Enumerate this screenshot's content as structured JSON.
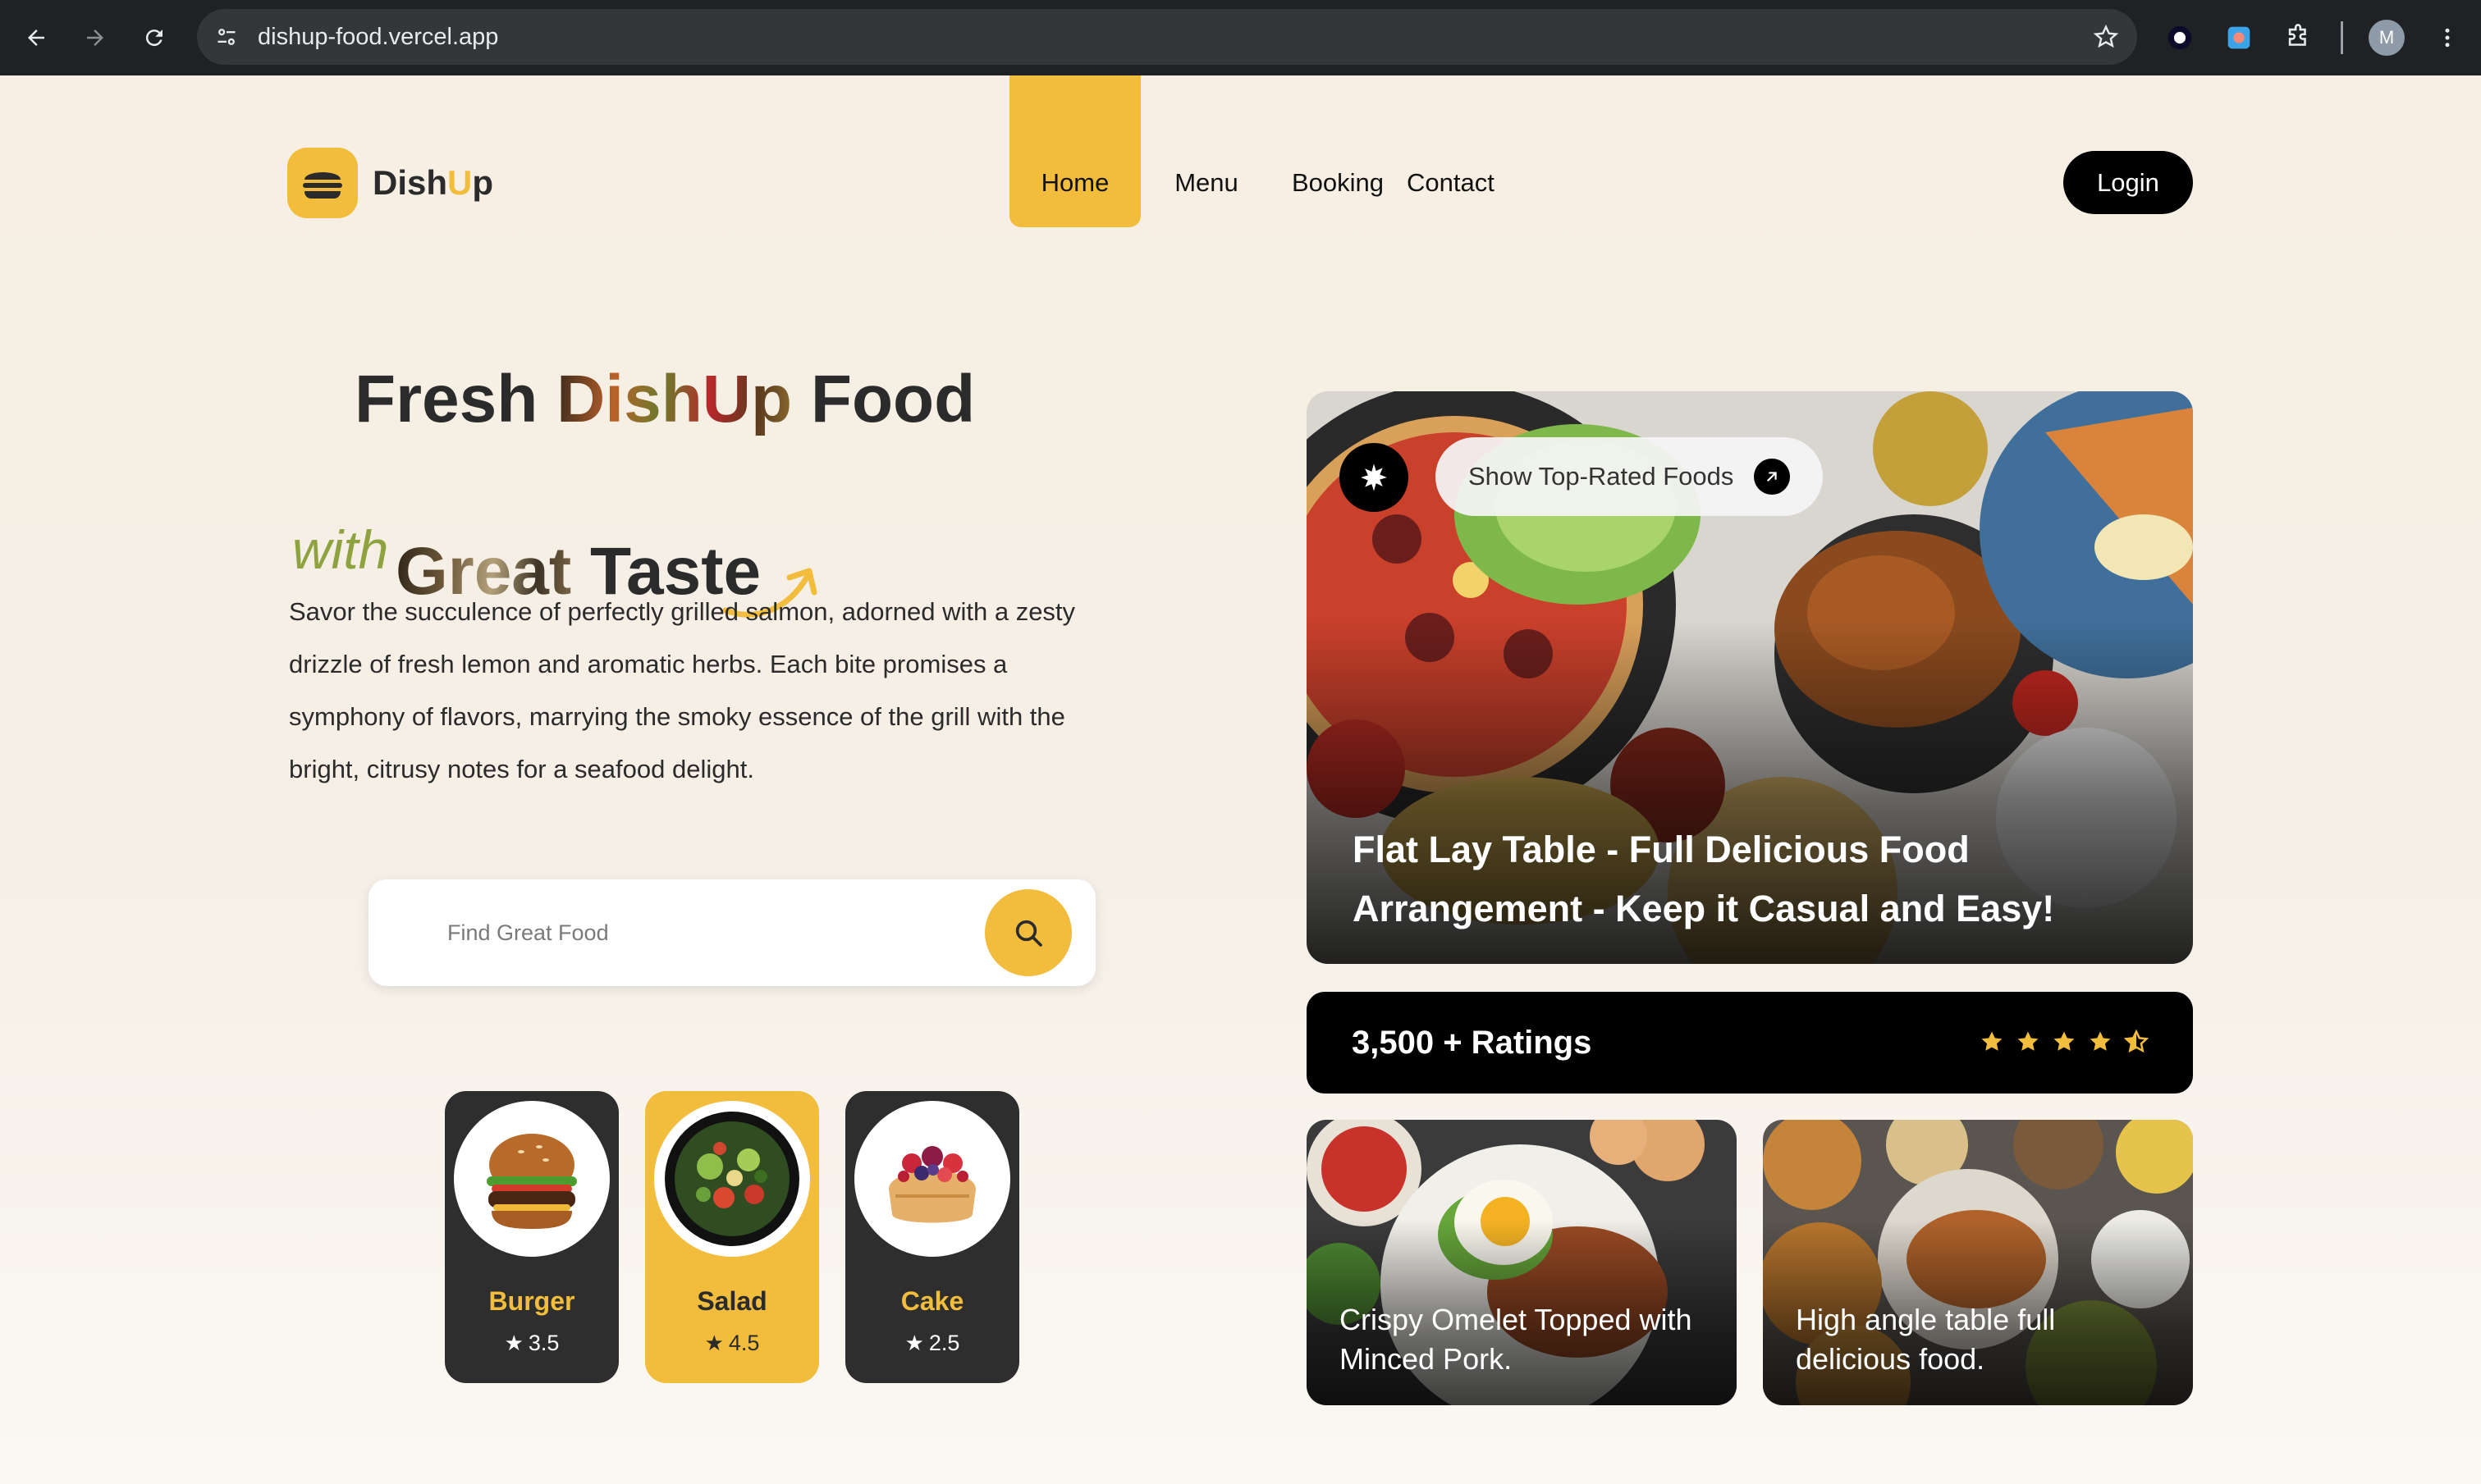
{
  "browser": {
    "url": "dishup-food.vercel.app",
    "profile_initial": "M"
  },
  "logo": {
    "text_main": "Dish",
    "text_accent": "U",
    "text_end": "p"
  },
  "nav": {
    "items": [
      {
        "label": "Home",
        "active": true
      },
      {
        "label": "Menu",
        "active": false
      },
      {
        "label": "Booking",
        "active": false
      },
      {
        "label": "Contact",
        "active": false
      }
    ],
    "login_label": "Login"
  },
  "hero": {
    "title_prefix": "Fresh ",
    "title_image_word": "DishUp",
    "title_suffix": " Food",
    "with_word": "with",
    "subtitle_image_word": "Great",
    "subtitle_suffix": " Taste",
    "description": "Savor the succulence of perfectly grilled salmon, adorned with a zesty drizzle of fresh lemon and aromatic herbs. Each bite promises a symphony of flavors, marrying the smoky essence of the grill with the bright, citrusy notes for a seafood delight."
  },
  "search": {
    "placeholder": "Find Great Food",
    "value": ""
  },
  "categories": [
    {
      "name": "Burger",
      "rating": "3.5",
      "active": false,
      "icon": "burger-photo"
    },
    {
      "name": "Salad",
      "rating": "4.5",
      "active": true,
      "icon": "salad-photo"
    },
    {
      "name": "Cake",
      "rating": "2.5",
      "active": false,
      "icon": "cake-photo"
    }
  ],
  "feature": {
    "pill_label": "Show Top-Rated Foods",
    "title": "Flat Lay Table - Full Delicious Food Arrangement - Keep it Casual and Easy!"
  },
  "ratings": {
    "label": "3,500 + Ratings",
    "stars": 4.5
  },
  "mini_cards": [
    {
      "title": "Crispy Omelet Topped with Minced Pork."
    },
    {
      "title": "High angle table full delicious food."
    }
  ],
  "colors": {
    "accent": "#f2bd3c",
    "dark": "#2e2e2e",
    "black": "#000000",
    "with_green": "#8ea23f"
  }
}
